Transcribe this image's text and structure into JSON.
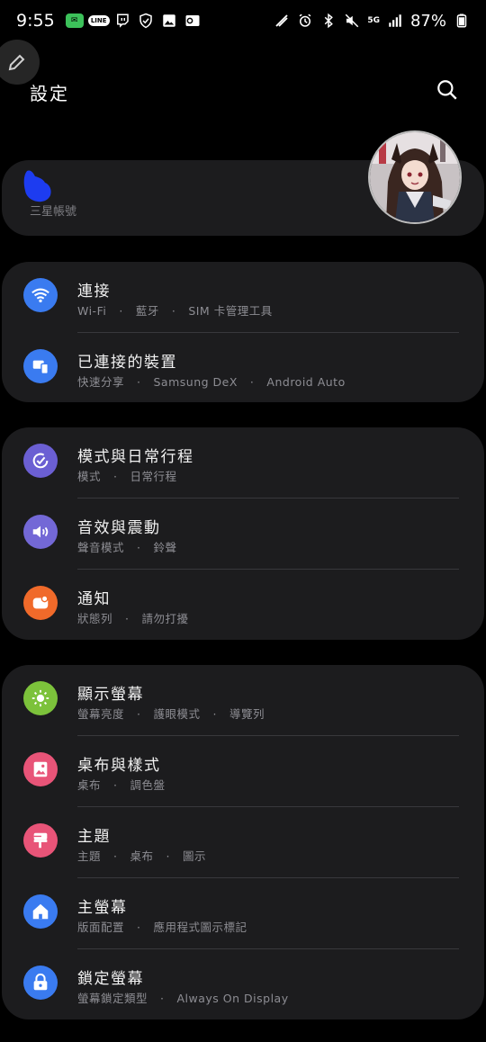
{
  "status_bar": {
    "time": "9:55",
    "network": "5G",
    "battery": "87%"
  },
  "header": {
    "title": "設定",
    "search_icon": "search-icon",
    "edit_icon": "pencil-icon"
  },
  "account": {
    "label": "三星帳號"
  },
  "groups": [
    {
      "items": [
        {
          "title": "連接",
          "subs": [
            "Wi-Fi",
            "藍牙",
            "SIM 卡管理工具"
          ],
          "icon": "wifi-icon",
          "color": "#3a7bf0"
        },
        {
          "title": "已連接的裝置",
          "subs": [
            "快速分享",
            "Samsung DeX",
            "Android Auto"
          ],
          "icon": "devices-icon",
          "color": "#3a7bf0"
        }
      ]
    },
    {
      "items": [
        {
          "title": "模式與日常行程",
          "subs": [
            "模式",
            "日常行程"
          ],
          "icon": "check-circle-icon",
          "color": "#6b5fd3"
        },
        {
          "title": "音效與震動",
          "subs": [
            "聲音模式",
            "鈴聲"
          ],
          "icon": "speaker-icon",
          "color": "#7368d6"
        },
        {
          "title": "通知",
          "subs": [
            "狀態列",
            "請勿打擾"
          ],
          "icon": "notification-icon",
          "color": "#f06a2a"
        }
      ]
    },
    {
      "items": [
        {
          "title": "顯示螢幕",
          "subs": [
            "螢幕亮度",
            "護眼模式",
            "導覽列"
          ],
          "icon": "sun-icon",
          "color": "#7cc23b"
        },
        {
          "title": "桌布與樣式",
          "subs": [
            "桌布",
            "調色盤"
          ],
          "icon": "wallpaper-icon",
          "color": "#e85478"
        },
        {
          "title": "主題",
          "subs": [
            "主題",
            "桌布",
            "圖示"
          ],
          "icon": "paint-brush-icon",
          "color": "#e85478"
        },
        {
          "title": "主螢幕",
          "subs": [
            "版面配置",
            "應用程式圖示標記"
          ],
          "icon": "home-icon",
          "color": "#3a7bf0"
        },
        {
          "title": "鎖定螢幕",
          "subs": [
            "螢幕鎖定類型",
            "Always On Display"
          ],
          "icon": "lock-icon",
          "color": "#3a7bf0"
        }
      ]
    }
  ]
}
